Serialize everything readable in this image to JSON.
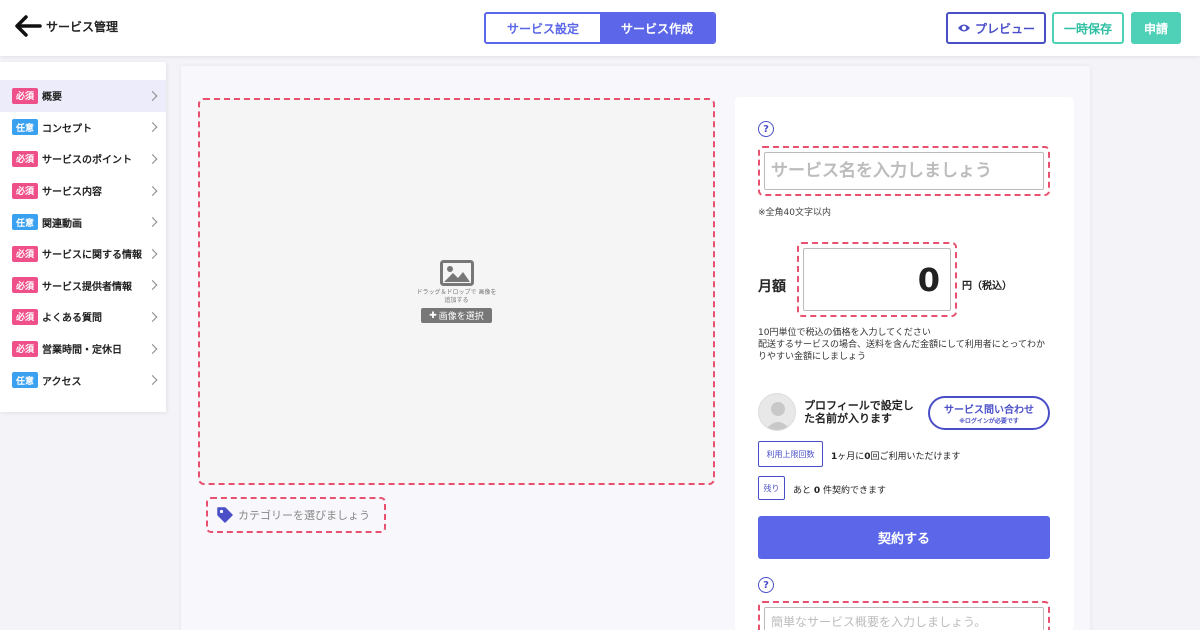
{
  "header": {
    "back_label": "サービス管理",
    "tabs": [
      {
        "label": "サービス設定",
        "active": false
      },
      {
        "label": "サービス作成",
        "active": true
      }
    ],
    "preview_label": "プレビュー",
    "save_label": "一時保存",
    "apply_label": "申請"
  },
  "sidebar": {
    "items": [
      {
        "badge": "必須",
        "badge_type": "required",
        "label": "概要",
        "selected": true
      },
      {
        "badge": "任意",
        "badge_type": "optional",
        "label": "コンセプト"
      },
      {
        "badge": "必須",
        "badge_type": "required",
        "label": "サービスのポイント"
      },
      {
        "badge": "必須",
        "badge_type": "required",
        "label": "サービス内容"
      },
      {
        "badge": "任意",
        "badge_type": "optional",
        "label": "関連動画"
      },
      {
        "badge": "必須",
        "badge_type": "required",
        "label": "サービスに関する情報"
      },
      {
        "badge": "必須",
        "badge_type": "required",
        "label": "サービス提供者情報"
      },
      {
        "badge": "必須",
        "badge_type": "required",
        "label": "よくある質問"
      },
      {
        "badge": "必須",
        "badge_type": "required",
        "label": "営業時間・定休日"
      },
      {
        "badge": "任意",
        "badge_type": "optional",
        "label": "アクセス"
      }
    ]
  },
  "image_upload": {
    "drop_text": "ドラッグ＆ドロップで 画像を追加する",
    "select_label": "画像を選択"
  },
  "category": {
    "placeholder": "カテゴリーを選びましょう"
  },
  "form": {
    "help_symbol": "?",
    "name_placeholder": "サービス名を入力しましょう",
    "name_note": "※全角40文字以内",
    "monthly_label": "月額",
    "price_value": "0",
    "price_unit": "円（税込）",
    "price_note_1": "10円単位で税込の価格を入力してください",
    "price_note_2": "配送するサービスの場合、送料を含んだ金額にして利用者にとってわかりやすい金額にしましょう",
    "profile_text": "プロフィールで設定した名前が入ります",
    "inquiry_label": "サービス問い合わせ",
    "inquiry_sub": "※ログインが必要です",
    "limit_tag": "利用上限回数",
    "limit_pre": "1",
    "limit_mid": "ヶ月に",
    "limit_count": "0",
    "limit_post": "回ご利用いただけます",
    "remaining_tag": "残り",
    "remaining_pre": "あと",
    "remaining_count": "0",
    "remaining_post": "件契約できます",
    "contract_label": "契約する",
    "summary_placeholder": "簡単なサービス概要を入力しましょう。"
  },
  "colors": {
    "accent": "#5b67e8",
    "required": "#f0508a",
    "optional": "#3aa0f0",
    "teal": "#4fd1b8",
    "dashed": "#e8506f"
  }
}
